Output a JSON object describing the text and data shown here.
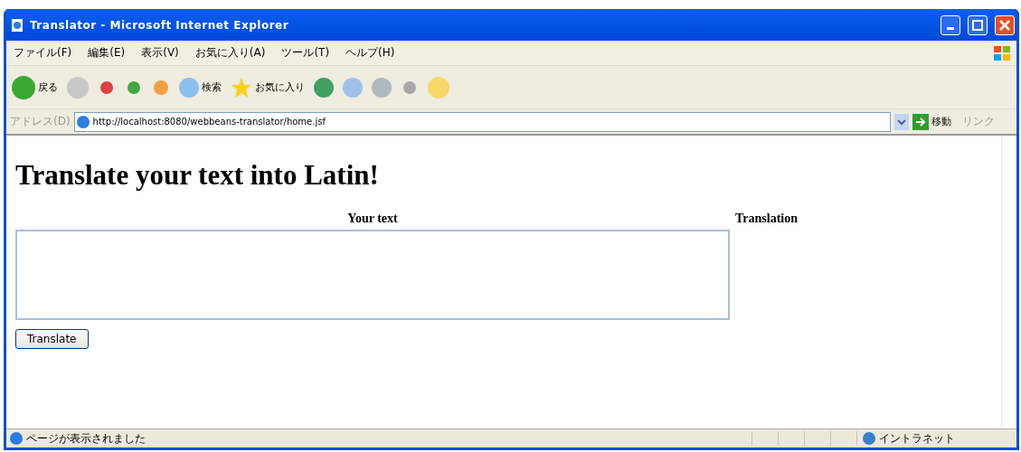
{
  "window": {
    "title": "Translator - Microsoft Internet Explorer"
  },
  "menu": [
    "ファイル(F)",
    "編集(E)",
    "表示(V)",
    "お気に入り(A)",
    "ツール(T)",
    "ヘルプ(H)"
  ],
  "toolbar": {
    "back": "戻る",
    "search": "検索",
    "favorites": "お気に入り"
  },
  "address": {
    "label": "アドレス(D)",
    "url": "http://localhost:8080/webbeans-translator/home.jsf",
    "go": "移動",
    "links": "リンク"
  },
  "page": {
    "heading": "Translate your text into Latin!",
    "input_label": "Your text",
    "output_label": "Translation",
    "button": "Translate"
  },
  "status_bar": {
    "message": "ページが表示されました",
    "zone": "イントラネット"
  }
}
